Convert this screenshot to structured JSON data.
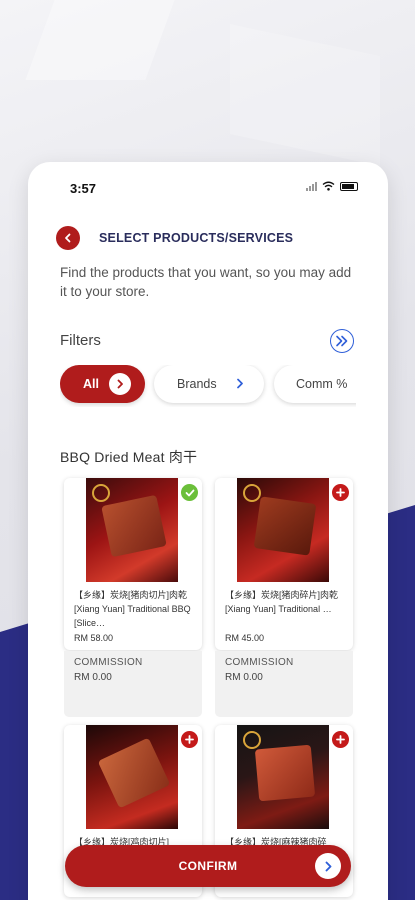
{
  "status_bar": {
    "time": "3:57"
  },
  "header": {
    "title": "SELECT PRODUCTS/SERVICES"
  },
  "description": "Find the products that you want, so you may add it to your store.",
  "filters": {
    "label": "Filters",
    "chips": [
      {
        "label": "All",
        "selected": true
      },
      {
        "label": "Brands",
        "selected": false
      },
      {
        "label": "Comm %",
        "selected": false
      }
    ]
  },
  "section": {
    "title": "BBQ Dried Meat 肉干"
  },
  "products": [
    {
      "name": "【乡缘】炭烧[猪肉切片]肉乾 [Xiang Yuan] Traditional BBQ [Slice…",
      "price": "RM 58.00",
      "commission_label": "COMMISSION",
      "commission_value": "RM 0.00",
      "added": true,
      "badge_icon": "check-icon"
    },
    {
      "name": "【乡缘】炭烧[猪肉碎片]肉乾 [Xiang Yuan] Traditional …",
      "price": "RM 45.00",
      "commission_label": "COMMISSION",
      "commission_value": "RM 0.00",
      "added": false,
      "badge_icon": "plus-icon"
    },
    {
      "name": "【乡缘】炭烧[鸡肉切片]",
      "added": false,
      "badge_icon": "plus-icon"
    },
    {
      "name": "【乡缘】炭烧[麻辣猪肉碎",
      "added": false,
      "badge_icon": "plus-icon"
    }
  ],
  "confirm": {
    "label": "CONFIRM"
  },
  "colors": {
    "primary_red": "#b01c1c",
    "navy": "#2b2d84",
    "link_blue": "#2f5fd8",
    "check_green": "#6bbf3a"
  }
}
